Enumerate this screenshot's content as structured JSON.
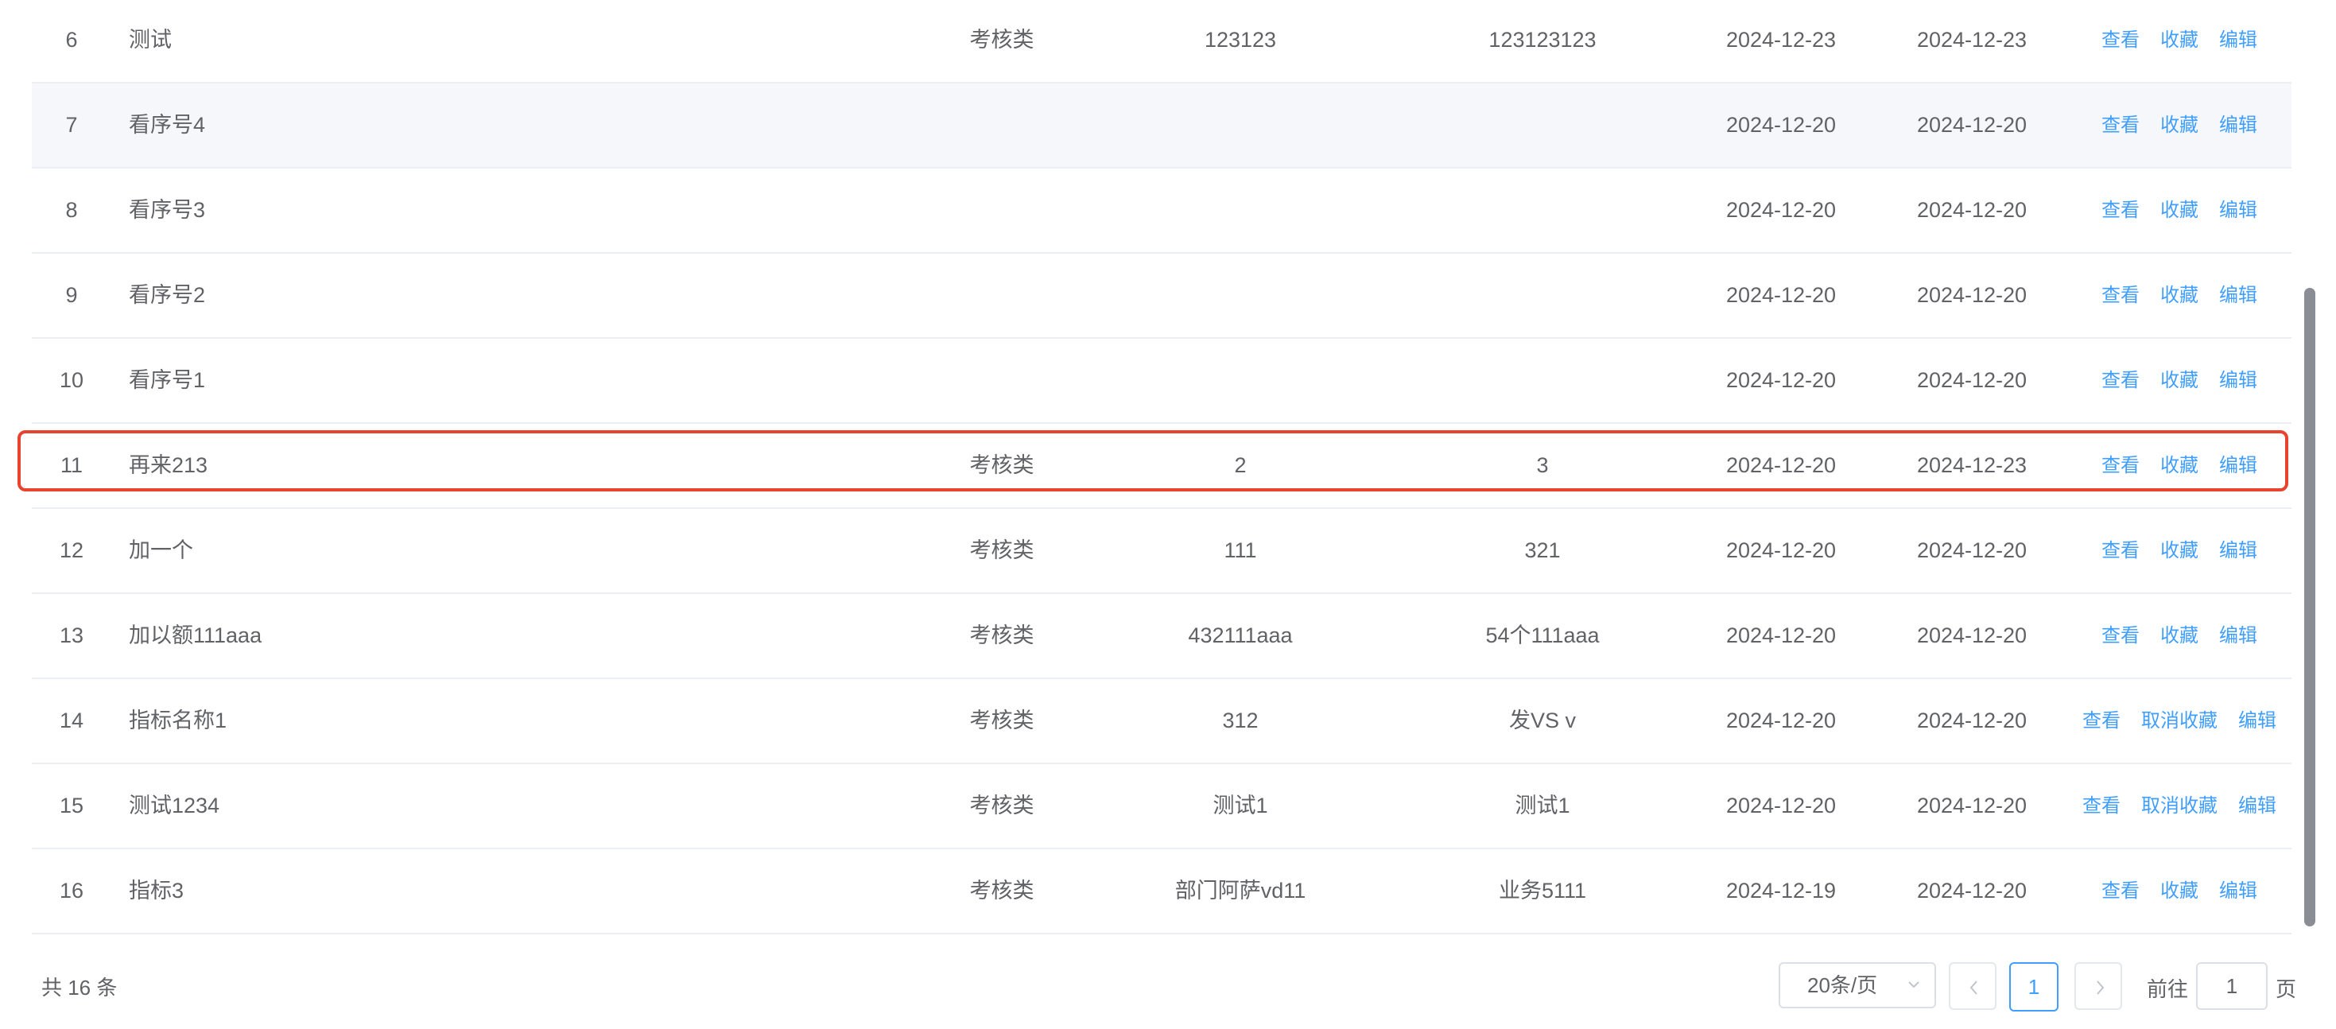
{
  "table": {
    "rows": [
      {
        "index": "6",
        "name": "测试",
        "type": "考核类",
        "value1": "123123",
        "value2": "123123123",
        "date1": "2024-12-23",
        "date2": "2024-12-23",
        "actions": [
          "查看",
          "收藏",
          "编辑"
        ]
      },
      {
        "index": "7",
        "name": "看序号4",
        "type": "",
        "value1": "",
        "value2": "",
        "date1": "2024-12-20",
        "date2": "2024-12-20",
        "actions": [
          "查看",
          "收藏",
          "编辑"
        ]
      },
      {
        "index": "8",
        "name": "看序号3",
        "type": "",
        "value1": "",
        "value2": "",
        "date1": "2024-12-20",
        "date2": "2024-12-20",
        "actions": [
          "查看",
          "收藏",
          "编辑"
        ]
      },
      {
        "index": "9",
        "name": "看序号2",
        "type": "",
        "value1": "",
        "value2": "",
        "date1": "2024-12-20",
        "date2": "2024-12-20",
        "actions": [
          "查看",
          "收藏",
          "编辑"
        ]
      },
      {
        "index": "10",
        "name": "看序号1",
        "type": "",
        "value1": "",
        "value2": "",
        "date1": "2024-12-20",
        "date2": "2024-12-20",
        "actions": [
          "查看",
          "收藏",
          "编辑"
        ]
      },
      {
        "index": "11",
        "name": "再来213",
        "type": "考核类",
        "value1": "2",
        "value2": "3",
        "date1": "2024-12-20",
        "date2": "2024-12-23",
        "actions": [
          "查看",
          "收藏",
          "编辑"
        ]
      },
      {
        "index": "12",
        "name": "加一个",
        "type": "考核类",
        "value1": "111",
        "value2": "321",
        "date1": "2024-12-20",
        "date2": "2024-12-20",
        "actions": [
          "查看",
          "收藏",
          "编辑"
        ]
      },
      {
        "index": "13",
        "name": "加以额111aaa",
        "type": "考核类",
        "value1": "432111aaa",
        "value2": "54个111aaa",
        "date1": "2024-12-20",
        "date2": "2024-12-20",
        "actions": [
          "查看",
          "收藏",
          "编辑"
        ]
      },
      {
        "index": "14",
        "name": "指标名称1",
        "type": "考核类",
        "value1": "312",
        "value2": "发VS v",
        "date1": "2024-12-20",
        "date2": "2024-12-20",
        "actions": [
          "查看",
          "取消收藏",
          "编辑"
        ]
      },
      {
        "index": "15",
        "name": "测试1234",
        "type": "考核类",
        "value1": "测试1",
        "value2": "测试1",
        "date1": "2024-12-20",
        "date2": "2024-12-20",
        "actions": [
          "查看",
          "取消收藏",
          "编辑"
        ]
      },
      {
        "index": "16",
        "name": "指标3",
        "type": "考核类",
        "value1": "部门阿萨vd11",
        "value2": "业务5111",
        "date1": "2024-12-19",
        "date2": "2024-12-20",
        "actions": [
          "查看",
          "收藏",
          "编辑"
        ]
      }
    ]
  },
  "pagination": {
    "total_text": "共 16 条",
    "page_size_label": "20条/页",
    "current_page": "1",
    "goto_label": "前往",
    "goto_value": "1",
    "page_suffix": "页"
  },
  "colors": {
    "link": "#409eff",
    "highlight_border": "#e8432e",
    "hover_row": "#f5f7fa"
  },
  "icons": [
    "chevron-down-icon",
    "chevron-left-icon",
    "chevron-right-icon"
  ]
}
